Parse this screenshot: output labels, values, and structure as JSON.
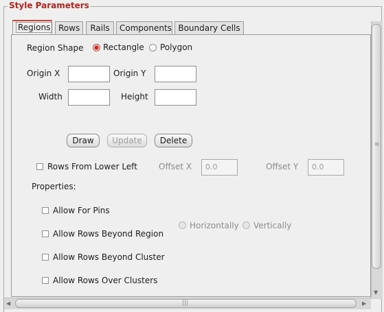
{
  "group": {
    "title": "Style Parameters"
  },
  "tabs": [
    {
      "label": "Regions",
      "active": true
    },
    {
      "label": "Rows"
    },
    {
      "label": "Rails"
    },
    {
      "label": "Components"
    },
    {
      "label": "Boundary Cells"
    }
  ],
  "region": {
    "shape_label": "Region Shape",
    "shape_options": [
      {
        "label": "Rectangle",
        "selected": true
      },
      {
        "label": "Polygon",
        "selected": false
      }
    ],
    "origin_x_label": "Origin X",
    "origin_y_label": "Origin Y",
    "width_label": "Width",
    "height_label": "Height",
    "origin_x_value": "",
    "origin_y_value": "",
    "width_value": "",
    "height_value": ""
  },
  "buttons": {
    "draw": "Draw",
    "update": "Update",
    "delete": "Delete"
  },
  "rows_from_lower_left": {
    "label": "Rows From Lower Left",
    "checked": false,
    "offset_x_label": "Offset X",
    "offset_x_value": "0.0",
    "offset_y_label": "Offset Y",
    "offset_y_value": "0.0"
  },
  "properties": {
    "label": "Properties:",
    "options": [
      {
        "label": "Allow For Pins",
        "checked": false
      },
      {
        "label": "Allow Rows Beyond Region",
        "checked": false
      },
      {
        "label": "Allow Rows Beyond Cluster",
        "checked": false
      },
      {
        "label": "Allow Rows Over Clusters",
        "checked": false
      }
    ],
    "direction_options": [
      {
        "label": "Horizontally",
        "selected": false
      },
      {
        "label": "Vertically",
        "selected": false
      }
    ]
  },
  "colors": {
    "title_red": "#b2251f",
    "radio_red": "#cf2a22",
    "background": "#efefef"
  }
}
